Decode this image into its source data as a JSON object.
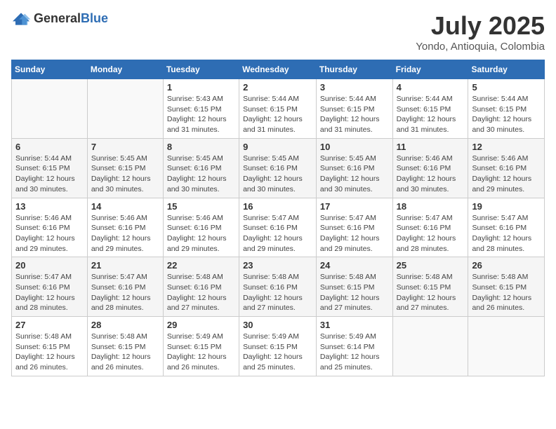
{
  "header": {
    "logo_general": "General",
    "logo_blue": "Blue",
    "month_year": "July 2025",
    "location": "Yondo, Antioquia, Colombia"
  },
  "days_of_week": [
    "Sunday",
    "Monday",
    "Tuesday",
    "Wednesday",
    "Thursday",
    "Friday",
    "Saturday"
  ],
  "weeks": [
    [
      {
        "day": "",
        "sunrise": "",
        "sunset": "",
        "daylight": ""
      },
      {
        "day": "",
        "sunrise": "",
        "sunset": "",
        "daylight": ""
      },
      {
        "day": "1",
        "sunrise": "Sunrise: 5:43 AM",
        "sunset": "Sunset: 6:15 PM",
        "daylight": "Daylight: 12 hours and 31 minutes."
      },
      {
        "day": "2",
        "sunrise": "Sunrise: 5:44 AM",
        "sunset": "Sunset: 6:15 PM",
        "daylight": "Daylight: 12 hours and 31 minutes."
      },
      {
        "day": "3",
        "sunrise": "Sunrise: 5:44 AM",
        "sunset": "Sunset: 6:15 PM",
        "daylight": "Daylight: 12 hours and 31 minutes."
      },
      {
        "day": "4",
        "sunrise": "Sunrise: 5:44 AM",
        "sunset": "Sunset: 6:15 PM",
        "daylight": "Daylight: 12 hours and 31 minutes."
      },
      {
        "day": "5",
        "sunrise": "Sunrise: 5:44 AM",
        "sunset": "Sunset: 6:15 PM",
        "daylight": "Daylight: 12 hours and 30 minutes."
      }
    ],
    [
      {
        "day": "6",
        "sunrise": "Sunrise: 5:44 AM",
        "sunset": "Sunset: 6:15 PM",
        "daylight": "Daylight: 12 hours and 30 minutes."
      },
      {
        "day": "7",
        "sunrise": "Sunrise: 5:45 AM",
        "sunset": "Sunset: 6:15 PM",
        "daylight": "Daylight: 12 hours and 30 minutes."
      },
      {
        "day": "8",
        "sunrise": "Sunrise: 5:45 AM",
        "sunset": "Sunset: 6:16 PM",
        "daylight": "Daylight: 12 hours and 30 minutes."
      },
      {
        "day": "9",
        "sunrise": "Sunrise: 5:45 AM",
        "sunset": "Sunset: 6:16 PM",
        "daylight": "Daylight: 12 hours and 30 minutes."
      },
      {
        "day": "10",
        "sunrise": "Sunrise: 5:45 AM",
        "sunset": "Sunset: 6:16 PM",
        "daylight": "Daylight: 12 hours and 30 minutes."
      },
      {
        "day": "11",
        "sunrise": "Sunrise: 5:46 AM",
        "sunset": "Sunset: 6:16 PM",
        "daylight": "Daylight: 12 hours and 30 minutes."
      },
      {
        "day": "12",
        "sunrise": "Sunrise: 5:46 AM",
        "sunset": "Sunset: 6:16 PM",
        "daylight": "Daylight: 12 hours and 29 minutes."
      }
    ],
    [
      {
        "day": "13",
        "sunrise": "Sunrise: 5:46 AM",
        "sunset": "Sunset: 6:16 PM",
        "daylight": "Daylight: 12 hours and 29 minutes."
      },
      {
        "day": "14",
        "sunrise": "Sunrise: 5:46 AM",
        "sunset": "Sunset: 6:16 PM",
        "daylight": "Daylight: 12 hours and 29 minutes."
      },
      {
        "day": "15",
        "sunrise": "Sunrise: 5:46 AM",
        "sunset": "Sunset: 6:16 PM",
        "daylight": "Daylight: 12 hours and 29 minutes."
      },
      {
        "day": "16",
        "sunrise": "Sunrise: 5:47 AM",
        "sunset": "Sunset: 6:16 PM",
        "daylight": "Daylight: 12 hours and 29 minutes."
      },
      {
        "day": "17",
        "sunrise": "Sunrise: 5:47 AM",
        "sunset": "Sunset: 6:16 PM",
        "daylight": "Daylight: 12 hours and 29 minutes."
      },
      {
        "day": "18",
        "sunrise": "Sunrise: 5:47 AM",
        "sunset": "Sunset: 6:16 PM",
        "daylight": "Daylight: 12 hours and 28 minutes."
      },
      {
        "day": "19",
        "sunrise": "Sunrise: 5:47 AM",
        "sunset": "Sunset: 6:16 PM",
        "daylight": "Daylight: 12 hours and 28 minutes."
      }
    ],
    [
      {
        "day": "20",
        "sunrise": "Sunrise: 5:47 AM",
        "sunset": "Sunset: 6:16 PM",
        "daylight": "Daylight: 12 hours and 28 minutes."
      },
      {
        "day": "21",
        "sunrise": "Sunrise: 5:47 AM",
        "sunset": "Sunset: 6:16 PM",
        "daylight": "Daylight: 12 hours and 28 minutes."
      },
      {
        "day": "22",
        "sunrise": "Sunrise: 5:48 AM",
        "sunset": "Sunset: 6:16 PM",
        "daylight": "Daylight: 12 hours and 27 minutes."
      },
      {
        "day": "23",
        "sunrise": "Sunrise: 5:48 AM",
        "sunset": "Sunset: 6:16 PM",
        "daylight": "Daylight: 12 hours and 27 minutes."
      },
      {
        "day": "24",
        "sunrise": "Sunrise: 5:48 AM",
        "sunset": "Sunset: 6:15 PM",
        "daylight": "Daylight: 12 hours and 27 minutes."
      },
      {
        "day": "25",
        "sunrise": "Sunrise: 5:48 AM",
        "sunset": "Sunset: 6:15 PM",
        "daylight": "Daylight: 12 hours and 27 minutes."
      },
      {
        "day": "26",
        "sunrise": "Sunrise: 5:48 AM",
        "sunset": "Sunset: 6:15 PM",
        "daylight": "Daylight: 12 hours and 26 minutes."
      }
    ],
    [
      {
        "day": "27",
        "sunrise": "Sunrise: 5:48 AM",
        "sunset": "Sunset: 6:15 PM",
        "daylight": "Daylight: 12 hours and 26 minutes."
      },
      {
        "day": "28",
        "sunrise": "Sunrise: 5:48 AM",
        "sunset": "Sunset: 6:15 PM",
        "daylight": "Daylight: 12 hours and 26 minutes."
      },
      {
        "day": "29",
        "sunrise": "Sunrise: 5:49 AM",
        "sunset": "Sunset: 6:15 PM",
        "daylight": "Daylight: 12 hours and 26 minutes."
      },
      {
        "day": "30",
        "sunrise": "Sunrise: 5:49 AM",
        "sunset": "Sunset: 6:15 PM",
        "daylight": "Daylight: 12 hours and 25 minutes."
      },
      {
        "day": "31",
        "sunrise": "Sunrise: 5:49 AM",
        "sunset": "Sunset: 6:14 PM",
        "daylight": "Daylight: 12 hours and 25 minutes."
      },
      {
        "day": "",
        "sunrise": "",
        "sunset": "",
        "daylight": ""
      },
      {
        "day": "",
        "sunrise": "",
        "sunset": "",
        "daylight": ""
      }
    ]
  ]
}
